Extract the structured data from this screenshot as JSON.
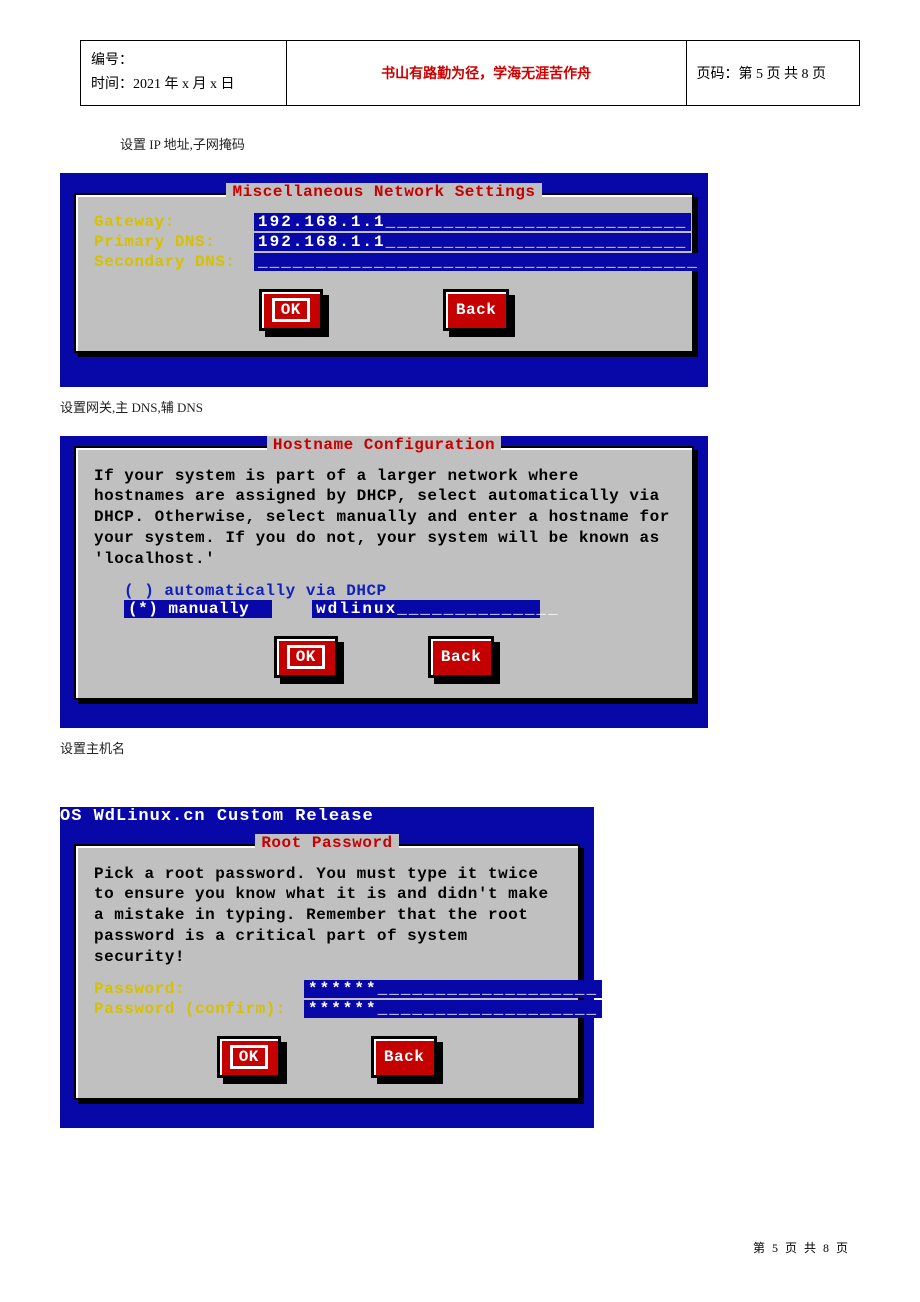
{
  "header": {
    "serial_label": "编号：",
    "time_label": "时间：",
    "time_value": "2021 年 x 月 x 日",
    "motto": "书山有路勤为径，学海无涯苦作舟",
    "page_label": "页码：",
    "page_value": "第 5 页 共 8 页"
  },
  "captions": {
    "c1": "设置 IP 地址,子网掩码",
    "c2": "设置网关,主 DNS,辅 DNS",
    "c3": "设置主机名"
  },
  "screens": {
    "net": {
      "title": "Miscellaneous Network Settings",
      "gateway_label": "Gateway:",
      "gateway_value": "192.168.1.1__________________________",
      "pdns_label": "Primary DNS:",
      "pdns_value": "192.168.1.1__________________________",
      "sdns_label": "Secondary DNS:",
      "sdns_value": "______________________________________",
      "ok": "OK",
      "back": "Back"
    },
    "host": {
      "title": "Hostname Configuration",
      "body": "If your system is part of a larger network where hostnames are assigned by DHCP, select automatically via DHCP. Otherwise, select manually and enter a hostname for your system. If you do not, your system will be known as 'localhost.'",
      "opt_auto": "( ) automatically via DHCP",
      "opt_manual": "(*) manually",
      "hostname": "wdlinux______________",
      "ok": "OK",
      "back": "Back"
    },
    "root": {
      "os_title": "OS WdLinux.cn Custom Release",
      "title": "Root Password",
      "body": "Pick a root password. You must type it twice to ensure you know what it is and didn't make a mistake in typing. Remember that the root password is a critical part of system security!",
      "pw_label": "Password:",
      "pw_value": "******___________________",
      "pw2_label": "Password (confirm):",
      "pw2_value": "******___________________",
      "ok": "OK",
      "back": "Back"
    }
  },
  "footer": "第 5 页 共 8 页"
}
